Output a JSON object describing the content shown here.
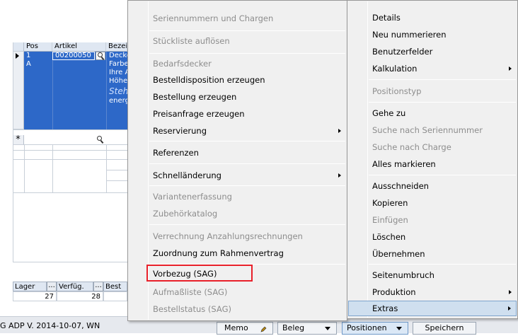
{
  "grid": {
    "columns": {
      "pos": "Pos",
      "artikel": "Artikel",
      "bezeichnung": "Bezei"
    },
    "row1": {
      "pos": "1",
      "artikel": "00200050"
    },
    "row2": {
      "pos": "A"
    },
    "desc_lines": [
      "Decke",
      "Farbe",
      "Ihre A",
      "Höhe",
      "Steh",
      "energ"
    ],
    "new_row_marker": "*"
  },
  "footer_grid": {
    "lager_label": "Lager",
    "verfueg_label": "Verfüg.",
    "best_label": "Best",
    "btn_ellipsis": "...",
    "lager_value": "27",
    "verfueg_value": "28"
  },
  "status_bar": {
    "version_text": "G ADP V. 2014-10-07, WN",
    "memo_label": "Memo",
    "beleg_label": "Beleg",
    "positionen_label": "Positionen",
    "speichern_label": "Speichern"
  },
  "menu_left": {
    "items": [
      {
        "label": "Seriennummern und Chargen",
        "enabled": false
      },
      {
        "label": "Stückliste auflösen",
        "enabled": false
      },
      {
        "label": "Bedarfsdecker",
        "enabled": false
      },
      {
        "label": "Bestelldisposition erzeugen",
        "enabled": true
      },
      {
        "label": "Bestellung erzeugen",
        "enabled": true
      },
      {
        "label": "Preisanfrage erzeugen",
        "enabled": true
      },
      {
        "label": "Reservierung",
        "enabled": true,
        "submenu": true
      },
      {
        "label": "Referenzen",
        "enabled": true
      },
      {
        "label": "Schnelländerung",
        "enabled": true,
        "submenu": true
      },
      {
        "label": "Variantenerfassung",
        "enabled": false
      },
      {
        "label": "Zubehörkatalog",
        "enabled": false
      },
      {
        "label": "Verrechnung Anzahlungsrechnungen",
        "enabled": false
      },
      {
        "label": "Zuordnung zum Rahmenvertrag",
        "enabled": true
      },
      {
        "label": "Vorbezug (SAG)",
        "enabled": true,
        "highlighted_red": true
      },
      {
        "label": "Aufmaßliste (SAG)",
        "enabled": false
      },
      {
        "label": "Bestellstatus (SAG)",
        "enabled": false
      }
    ]
  },
  "menu_right": {
    "items": [
      {
        "label": "Details",
        "enabled": true
      },
      {
        "label": "Neu nummerieren",
        "enabled": true
      },
      {
        "label": "Benutzerfelder",
        "enabled": true
      },
      {
        "label": "Kalkulation",
        "enabled": true,
        "submenu": true
      },
      {
        "label": "Positionstyp",
        "enabled": false
      },
      {
        "label": "Gehe zu",
        "enabled": true
      },
      {
        "label": "Suche nach Seriennummer",
        "enabled": false
      },
      {
        "label": "Suche nach Charge",
        "enabled": false
      },
      {
        "label": "Alles markieren",
        "enabled": true
      },
      {
        "label": "Ausschneiden",
        "enabled": true
      },
      {
        "label": "Kopieren",
        "enabled": true
      },
      {
        "label": "Einfügen",
        "enabled": false
      },
      {
        "label": "Löschen",
        "enabled": true
      },
      {
        "label": "Übernehmen",
        "enabled": true
      },
      {
        "label": "Seitenumbruch",
        "enabled": true
      },
      {
        "label": "Produktion",
        "enabled": true,
        "submenu": true
      },
      {
        "label": "Extras",
        "enabled": true,
        "submenu": true,
        "hover": true
      }
    ]
  },
  "colors": {
    "selection_blue": "#2d68c8",
    "menu_bg": "#f0f0f0",
    "hover_bg": "#cfdfef",
    "annotation_red": "#e8202a"
  }
}
